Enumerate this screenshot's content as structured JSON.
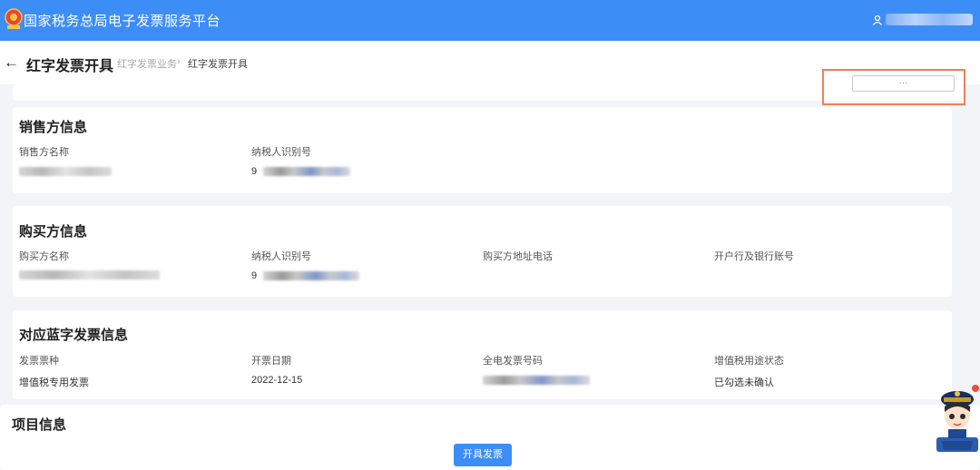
{
  "topbar": {
    "title": "国家税务总局电子发票服务平台"
  },
  "header": {
    "back_icon": "←",
    "title": "红字发票开具",
    "breadcrumb": [
      "红字发票业务",
      "›",
      "红字发票开具"
    ]
  },
  "toolbar": {
    "action_label": "···"
  },
  "seller": {
    "title": "销售方信息",
    "name_label": "销售方名称",
    "taxid_label": "纳税人识别号",
    "taxid_prefix": "9"
  },
  "buyer": {
    "title": "购买方信息",
    "name_label": "购买方名称",
    "taxid_label": "纳税人识别号",
    "address_label": "购买方地址电话",
    "bank_label": "开户行及银行账号",
    "taxid_prefix": "9"
  },
  "blue_invoice": {
    "title": "对应蓝字发票信息",
    "type_label": "发票票种",
    "date_label": "开票日期",
    "number_label": "全电发票号码",
    "vat_status_label": "增值税用途状态",
    "type_value": "增值税专用发票",
    "date_value": "2022-12-15",
    "vat_status_value": "已勾选未确认"
  },
  "items": {
    "title": "项目信息"
  },
  "footer": {
    "submit_label": "开具发票"
  },
  "colors": {
    "primary": "#3d8df6",
    "highlight": "#f07e5c"
  }
}
